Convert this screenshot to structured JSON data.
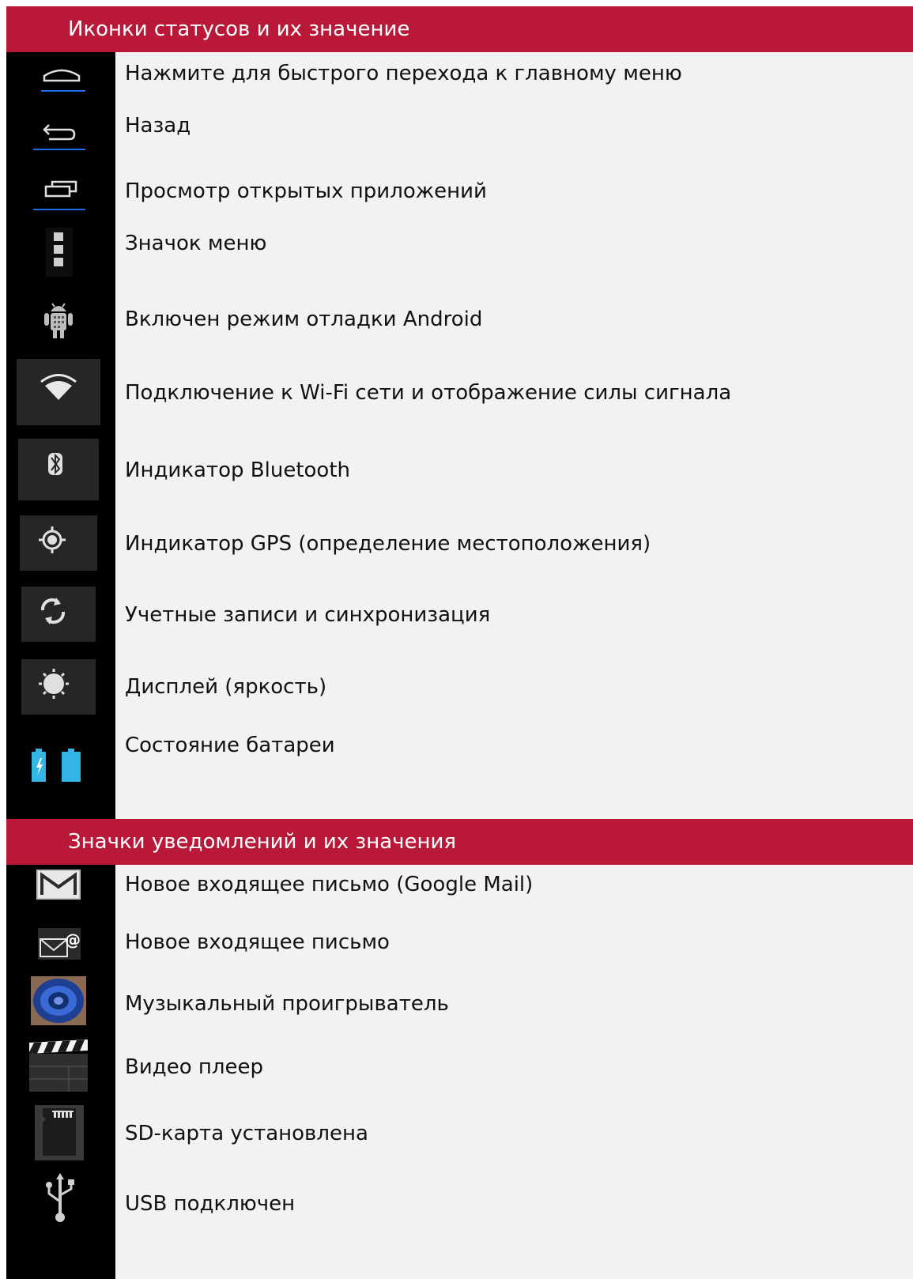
{
  "colors": {
    "header_bg": "#BA1839",
    "icon_column_bg": "#000000",
    "text_column_bg": "#F2F2F2",
    "nav_underline": "#1E6BE6",
    "battery_blue": "#33B5E5"
  },
  "status_section": {
    "title": "Иконки статусов и их значение",
    "rows": [
      {
        "icon": "home-icon",
        "label": "Нажмите для быстрого перехода к главному меню"
      },
      {
        "icon": "back-icon",
        "label": "Назад"
      },
      {
        "icon": "recent-apps-icon",
        "label": "Просмотр открытых приложений"
      },
      {
        "icon": "menu-icon",
        "label": "Значок меню"
      },
      {
        "icon": "android-debug-icon",
        "label": "Включен режим отладки Android"
      },
      {
        "icon": "wifi-icon",
        "label": "Подключение к Wi-Fi сети и отображение силы сигнала"
      },
      {
        "icon": "bluetooth-icon",
        "label": "Индикатор Bluetooth"
      },
      {
        "icon": "gps-icon",
        "label": "Индикатор GPS (определение местоположения)"
      },
      {
        "icon": "sync-icon",
        "label": "Учетные записи и синхронизация"
      },
      {
        "icon": "brightness-icon",
        "label": "Дисплей (яркость)"
      },
      {
        "icon": "battery-icon",
        "label": "Состояние батареи"
      }
    ]
  },
  "notification_section": {
    "title": "Значки уведомлений и их значения",
    "rows": [
      {
        "icon": "gmail-icon",
        "label": "Новое входящее письмо (Google Mail)"
      },
      {
        "icon": "email-icon",
        "label": "Новое входящее письмо"
      },
      {
        "icon": "music-player-icon",
        "label": "Музыкальный проигрыватель"
      },
      {
        "icon": "video-player-icon",
        "label": "Видео плеер"
      },
      {
        "icon": "sd-card-icon",
        "label": "SD-карта установлена"
      },
      {
        "icon": "usb-icon",
        "label": "USB подключен"
      }
    ]
  }
}
